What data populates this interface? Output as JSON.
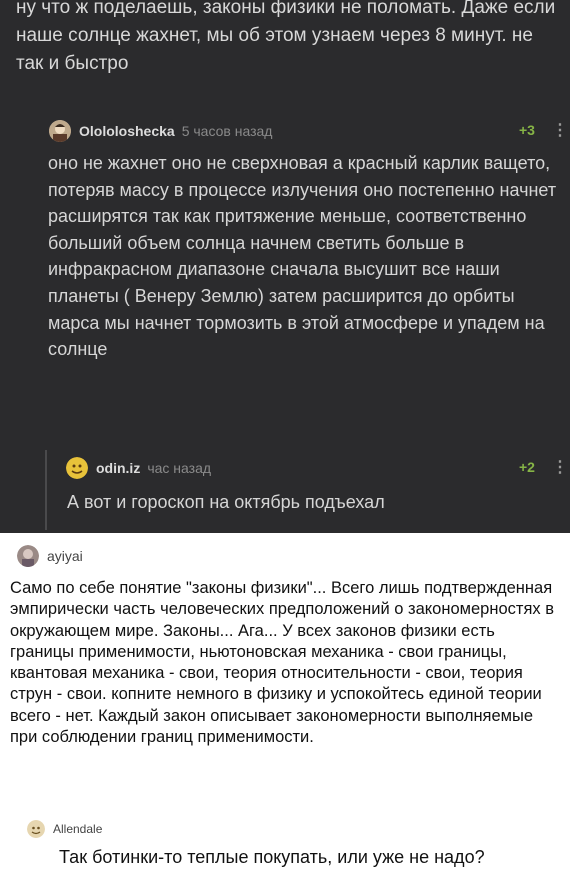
{
  "post": {
    "text": "ну что ж поделаешь, законы физики не поломать. Даже если наше солнце жахнет, мы об этом узнаем через 8 минут. не так и быстро"
  },
  "comment1": {
    "username": "Olololoshecka",
    "time": "5 часов назад",
    "score": "+3",
    "menu": "⋮",
    "body": "оно не жахнет оно не сверхновая а красный карлик ващето, потеряв массу в процессе излучения оно постепенно начнет расширятся так как притяжение меньше, соответственно больший объем солнца начнем светить больше в инфракрасном диапазоне сначала высушит все наши планеты ( Венеру Землю) затем расширится до орбиты марса мы начнет тормозить в этой атмосфере и упадем на солнце"
  },
  "comment2": {
    "username": "odin.iz",
    "time": "час назад",
    "score": "+2",
    "menu": "⋮",
    "body": "А вот и гороскоп на октябрь подъехал"
  },
  "comment3": {
    "username": "ayiyai",
    "body": "Само по себе понятие \"законы физики\"... Всего лишь подтвержденная эмпирически часть человеческих предположений о закономерностях в окружающем мире. Законы... Ага... У всех законов физики есть границы применимости, ньютоновская механика - свои границы, квантовая механика - свои, теория относительности - свои, теория струн - свои. копните немного в физику и успокойтесь единой теории всего - нет. Каждый закон описывает закономерности выполняемые при соблюдении границ применимости."
  },
  "comment4": {
    "username": "Allendale",
    "body": "Так ботинки-то теплые покупать, или уже не надо?"
  },
  "colors": {
    "dark_bg": "#2b2b2d",
    "score_green": "#86b446"
  }
}
